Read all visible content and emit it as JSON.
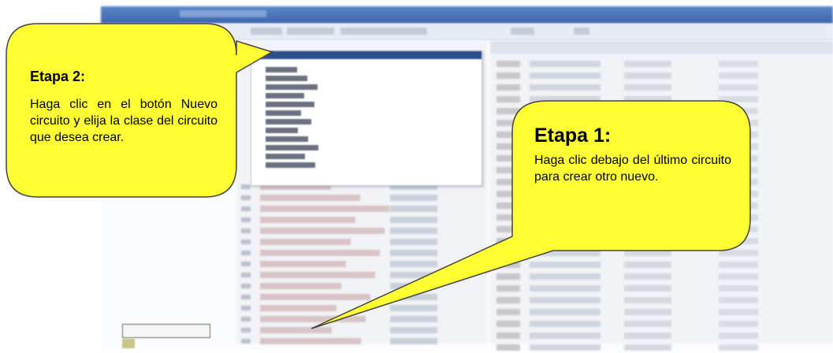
{
  "callout_step2": {
    "title": "Etapa 2:",
    "body": "Haga clic en el botón Nuevo circuito y elija la clase del circuito que desea crear.",
    "fill_color": "#ffff33",
    "border_color": "#444444"
  },
  "callout_step1": {
    "title": "Etapa 1:",
    "body": "Haga clic debajo del último circuito para crear otro nuevo.",
    "fill_color": "#ffff33",
    "border_color": "#444444"
  },
  "app": {
    "titlebar_color": "#3b64ad"
  }
}
